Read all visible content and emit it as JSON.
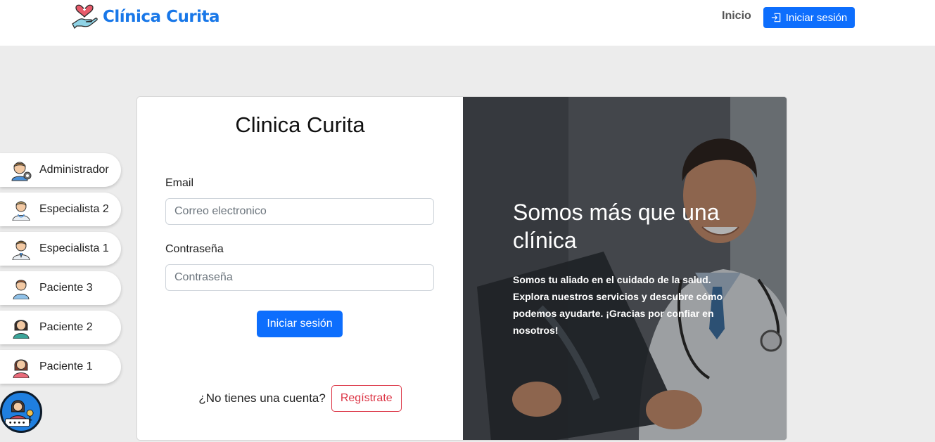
{
  "navbar": {
    "brand": "Clínica Curita",
    "home_link": "Inicio",
    "login_button": "Iniciar sesión"
  },
  "quick_users": [
    {
      "label": "Administrador",
      "icon": "admin-avatar-icon"
    },
    {
      "label": "Especialista 2",
      "icon": "doctor-avatar-icon"
    },
    {
      "label": "Especialista 1",
      "icon": "doctor-avatar-icon"
    },
    {
      "label": "Paciente 3",
      "icon": "patient-avatar-icon"
    },
    {
      "label": "Paciente 2",
      "icon": "patient-avatar-icon"
    },
    {
      "label": "Paciente 1",
      "icon": "patient-avatar-icon"
    }
  ],
  "login_form": {
    "title": "Clinica Curita",
    "email_label": "Email",
    "email_placeholder": "Correo electronico",
    "password_label": "Contraseña",
    "password_placeholder": "Contraseña",
    "submit_label": "Iniciar sesión",
    "signup_question": "¿No tienes una cuenta?",
    "signup_button": "Regístrate"
  },
  "hero": {
    "title": "Somos más que una clínica",
    "text": "Somos tu aliado en el cuidado de la salud. Explora nuestros servicios y descubre cómo podemos ayudarte. ¡Gracias por confiar en nosotros!"
  },
  "colors": {
    "brand": "#1877e8",
    "primary": "#0d6efd",
    "danger": "#dc3545",
    "page_background": "#ececec"
  }
}
